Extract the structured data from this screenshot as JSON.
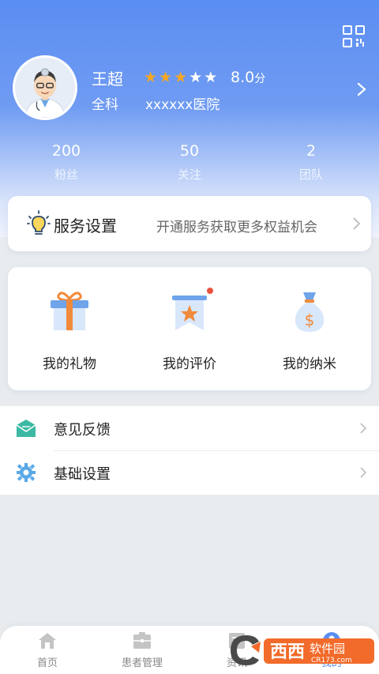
{
  "profile": {
    "name": "王超",
    "department": "全科",
    "hospital": "xxxxxx医院",
    "rating_stars": 5,
    "rating_filled": 3,
    "score": "8.0",
    "score_unit": "分"
  },
  "stats": [
    {
      "value": "200",
      "label": "粉丝"
    },
    {
      "value": "50",
      "label": "关注"
    },
    {
      "value": "2",
      "label": "团队"
    }
  ],
  "service": {
    "title": "服务设置",
    "description": "开通服务获取更多权益机会"
  },
  "grid": [
    {
      "label": "我的礼物",
      "icon": "gift-icon"
    },
    {
      "label": "我的评价",
      "icon": "review-badge-icon"
    },
    {
      "label": "我的纳米",
      "icon": "money-bag-icon"
    }
  ],
  "menu": [
    {
      "label": "意见反馈",
      "icon": "envelope-icon"
    },
    {
      "label": "基础设置",
      "icon": "gear-icon"
    }
  ],
  "tabbar": [
    {
      "label": "首页",
      "icon": "home-icon"
    },
    {
      "label": "患者管理",
      "icon": "folder-icon"
    },
    {
      "label": "资讯",
      "icon": "news-icon"
    },
    {
      "label": "我的",
      "icon": "user-icon"
    }
  ],
  "watermark": {
    "brand": "西西",
    "sub": "软件园",
    "url": "CR173.com"
  },
  "colors": {
    "primary": "#5b8ef2",
    "star_filled": "#f5a623",
    "star_empty": "#ffffff",
    "gift": "#f08a3c",
    "teal": "#3cb9a4",
    "gear": "#5aa8e8"
  }
}
